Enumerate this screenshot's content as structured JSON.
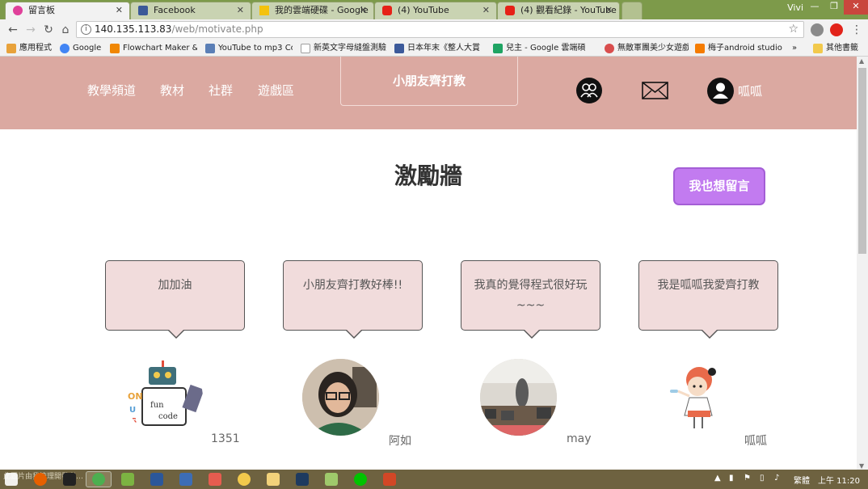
{
  "browser": {
    "tabs": [
      {
        "label": "留言板",
        "icon_color": "#e0409a",
        "active": true
      },
      {
        "label": "Facebook",
        "icon_color": "#3b5998",
        "active": false
      },
      {
        "label": "我的雲端硬碟 - Google",
        "icon_color": "#f4c20d",
        "active": false
      },
      {
        "label": "(4) YouTube",
        "icon_color": "#e62117",
        "active": false
      },
      {
        "label": "(4) 觀看紀錄 - YouTube",
        "icon_color": "#e62117",
        "active": false
      }
    ],
    "user": "Vivi",
    "url_host": "140.135.113.83",
    "url_path": "/web/motivate.php",
    "bookmarks": [
      {
        "label": "應用程式",
        "icon_color": "#e8a23b"
      },
      {
        "label": "Google",
        "icon_color": "#4285f4"
      },
      {
        "label": "Flowchart Maker &",
        "icon_color": "#f08705"
      },
      {
        "label": "YouTube to mp3 Co",
        "icon_color": "#5b7fb6"
      },
      {
        "label": "新英文字母縫盤測驗",
        "icon_color": "#9e9e9e"
      },
      {
        "label": "日本年末《整人大賞",
        "icon_color": "#3c5a9a"
      },
      {
        "label": "兒主 - Google 雲端碩",
        "icon_color": "#1fa463"
      },
      {
        "label": "無敵軍團美少女遊戲",
        "icon_color": "#d94e4e"
      },
      {
        "label": "梅子android studio",
        "icon_color": "#f57c00"
      }
    ],
    "bookmarks_more": "»",
    "bookmarks_other": "其他書籤"
  },
  "header": {
    "nav": [
      "教學頻道",
      "教材",
      "社群",
      "遊戲區"
    ],
    "brand": "小朋友齊打教",
    "user_name": "呱呱"
  },
  "main": {
    "title": "激勵牆",
    "leave_button": "我也想留言",
    "posts": [
      {
        "message": "加加油",
        "author": "1351",
        "avatar": "robot-mascot"
      },
      {
        "message": "小朋友齊打教好棒!!",
        "author": "阿如",
        "avatar": "girl-photo"
      },
      {
        "message": "我真的覺得程式很好玩~~~",
        "author": "may",
        "avatar": "classroom-photo"
      },
      {
        "message": "我是呱呱我愛齊打教",
        "author": "呱呱",
        "avatar": "cartoon-girl"
      }
    ]
  },
  "taskbar": {
    "caption": "此圖片由我管理開發者…",
    "tray_ime": "繁體",
    "tray_time": "上午 11:20"
  },
  "colors": {
    "header_bg": "#dba9a1",
    "bubble_bg": "#f1dcdc",
    "accent_button": "#c27bf0"
  }
}
